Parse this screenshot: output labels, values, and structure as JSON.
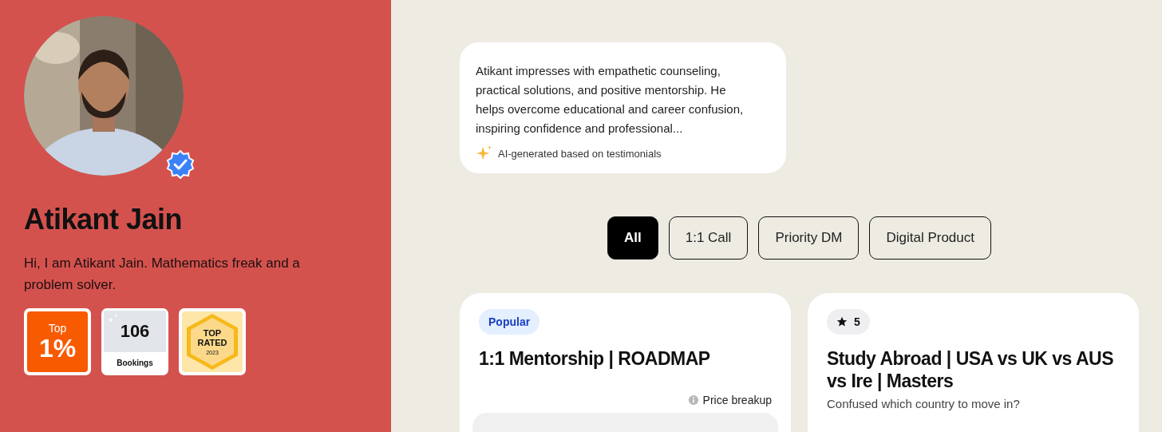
{
  "profile": {
    "name": "Atikant Jain",
    "bio": "Hi, I am Atikant Jain. Mathematics freak and a problem solver.",
    "verified": true
  },
  "badges": [
    {
      "kind": "top_percent",
      "prefix": "Top",
      "percent": "1%"
    },
    {
      "kind": "bookings",
      "count": "106",
      "caption": "Bookings"
    },
    {
      "kind": "top_rated",
      "line1": "TOP",
      "line2": "RATED",
      "year": "2023"
    }
  ],
  "summary": {
    "text": "Atikant impresses with empathetic counseling, practical solutions, and positive mentorship. He helps overcome educational and career confusion, inspiring confidence and professional...",
    "note": "AI-generated based on testimonials"
  },
  "filters": [
    {
      "label": "All",
      "selected": true
    },
    {
      "label": "1:1 Call",
      "selected": false
    },
    {
      "label": "Priority DM",
      "selected": false
    },
    {
      "label": "Digital Product",
      "selected": false
    }
  ],
  "services": [
    {
      "kind": "popular",
      "tag": "Popular",
      "title": "1:1 Mentorship | ROADMAP",
      "price_note": "Price breakup"
    },
    {
      "kind": "rated",
      "rating": "5",
      "title": "Study Abroad | USA vs UK vs AUS vs Ire | Masters",
      "subtitle": "Confused which country to move in?"
    }
  ]
}
